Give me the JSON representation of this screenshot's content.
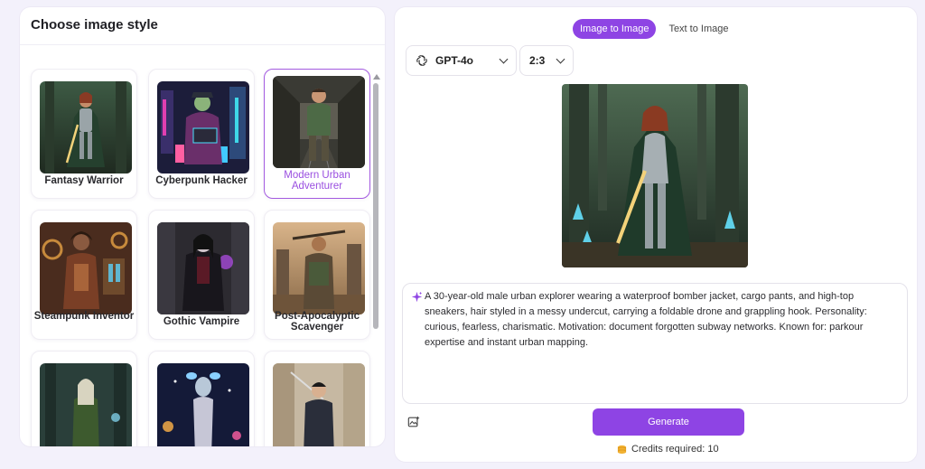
{
  "left": {
    "title": "Choose image style",
    "styles": [
      {
        "label": "Fantasy Warrior",
        "selected": false
      },
      {
        "label": "Cyberpunk Hacker",
        "selected": false
      },
      {
        "label": "Modern Urban Adventurer",
        "selected": true
      },
      {
        "label": "Steampunk Inventor",
        "selected": false
      },
      {
        "label": "Gothic Vampire",
        "selected": false
      },
      {
        "label": "Post-Apocalyptic Scavenger",
        "selected": false
      },
      {
        "label": "",
        "selected": false
      },
      {
        "label": "",
        "selected": false
      },
      {
        "label": "",
        "selected": false
      }
    ]
  },
  "right": {
    "tabs": [
      {
        "label": "Image to Image",
        "active": true
      },
      {
        "label": "Text to Image",
        "active": false
      }
    ],
    "model": {
      "value": "GPT-4o",
      "icon": "openai-icon"
    },
    "ratio": {
      "value": "2:3"
    },
    "prompt": "A 30-year-old male urban explorer wearing a waterproof bomber jacket, cargo pants, and high-top sneakers, hair styled in a messy undercut, carrying a foldable drone and grappling hook. Personality: curious, fearless, charismatic. Motivation: document forgotten subway networks. Known for: parkour expertise and instant urban mapping.",
    "generate_label": "Generate",
    "credits_label": "Credits required: 10"
  },
  "colors": {
    "accent": "#8e44e4",
    "selected_border": "#a35ae0",
    "background": "#f3f1fb"
  }
}
